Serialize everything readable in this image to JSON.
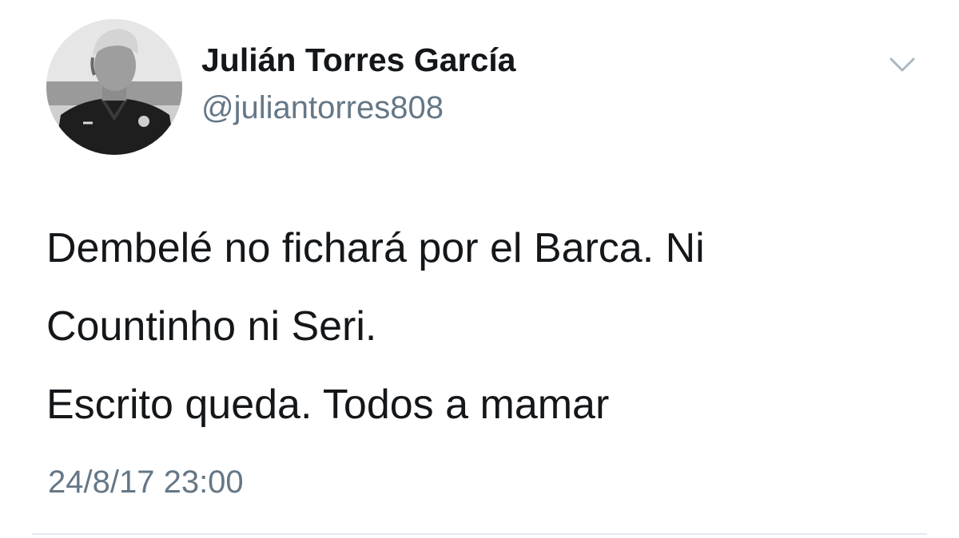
{
  "tweet": {
    "author": {
      "display_name": "Julián Torres García",
      "handle": "@juliantorres808",
      "avatar_icon": "user-avatar-photo"
    },
    "menu_icon": "chevron-down-icon",
    "text_lines": [
      "Dembelé no fichará por el Barca. Ni",
      "Countinho ni Seri.",
      "Escrito queda. Todos a mamar"
    ],
    "timestamp": "24/8/17 23:00"
  },
  "colors": {
    "text": "#14171a",
    "secondary_text": "#657786",
    "divider": "#e1e8ed",
    "chevron": "#aab8c2"
  }
}
